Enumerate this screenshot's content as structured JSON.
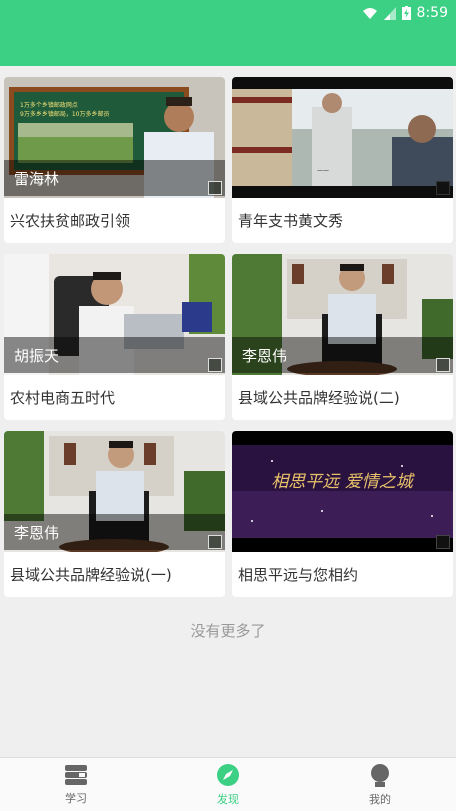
{
  "status_bar": {
    "time": "8:59"
  },
  "colors": {
    "accent": "#3cd085",
    "text": "#333333",
    "muted": "#999999"
  },
  "videos": [
    {
      "presenter": "雷海林",
      "caption": "兴农扶贫邮政引领"
    },
    {
      "presenter": "",
      "caption": "青年支书黄文秀"
    },
    {
      "presenter": "胡振天",
      "caption": "农村电商五时代"
    },
    {
      "presenter": "李恩伟",
      "caption": "县域公共品牌经验说(二)"
    },
    {
      "presenter": "李恩伟",
      "caption": "县域公共品牌经验说(一)"
    },
    {
      "presenter": "",
      "caption": "相思平远与您相约"
    }
  ],
  "thumb_texts": {
    "slide_line1": "1万多个乡镇邮政网点",
    "slide_line2": "9万多乡乡镇邮局，10万多乡邮员",
    "banner": "相思平远  爱情之城"
  },
  "footer": {
    "no_more": "没有更多了"
  },
  "tabs": [
    {
      "label": "学习",
      "icon": "book-stack-icon",
      "active": false
    },
    {
      "label": "发现",
      "icon": "compass-icon",
      "active": true
    },
    {
      "label": "我的",
      "icon": "person-icon",
      "active": false
    }
  ]
}
